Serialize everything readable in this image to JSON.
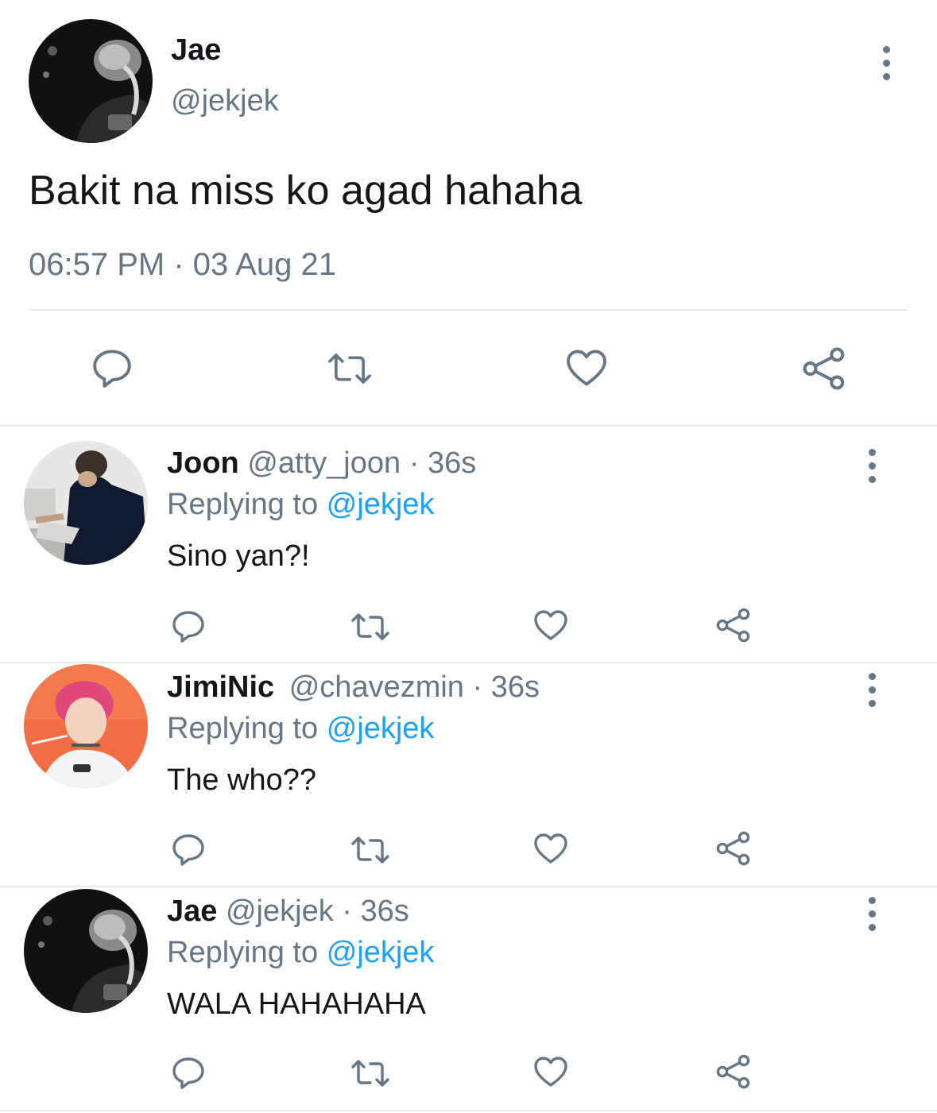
{
  "main_tweet": {
    "display_name": "Jae",
    "handle": "@jekjek",
    "text": "Bakit na miss ko agad hahaha",
    "timestamp": "06:57 PM · 03 Aug 21",
    "actions": {
      "reply_icon": "speech-bubble-icon",
      "retweet_icon": "retweet-icon",
      "like_icon": "heart-icon",
      "share_icon": "share-icon"
    }
  },
  "replies": [
    {
      "display_name": "Joon",
      "handle": "@atty_joon",
      "separator": "·",
      "time": "36s",
      "replying_prefix": "Replying to",
      "replying_handle": "@jekjek",
      "text": "Sino yan?!"
    },
    {
      "display_name": "JimiNic",
      "handle": "@chavezmin",
      "separator": "·",
      "time": "36s",
      "replying_prefix": "Replying to",
      "replying_handle": "@jekjek",
      "text": "The who??"
    },
    {
      "display_name": "Jae",
      "handle": "@jekjek",
      "separator": "·",
      "time": "36s",
      "replying_prefix": "Replying to",
      "replying_handle": "@jekjek",
      "text": "WALA HAHAHAHA"
    }
  ],
  "colors": {
    "text_primary": "#14171a",
    "text_secondary": "#657786",
    "link_blue": "#1da1f2",
    "divider": "#e6ecf0"
  }
}
